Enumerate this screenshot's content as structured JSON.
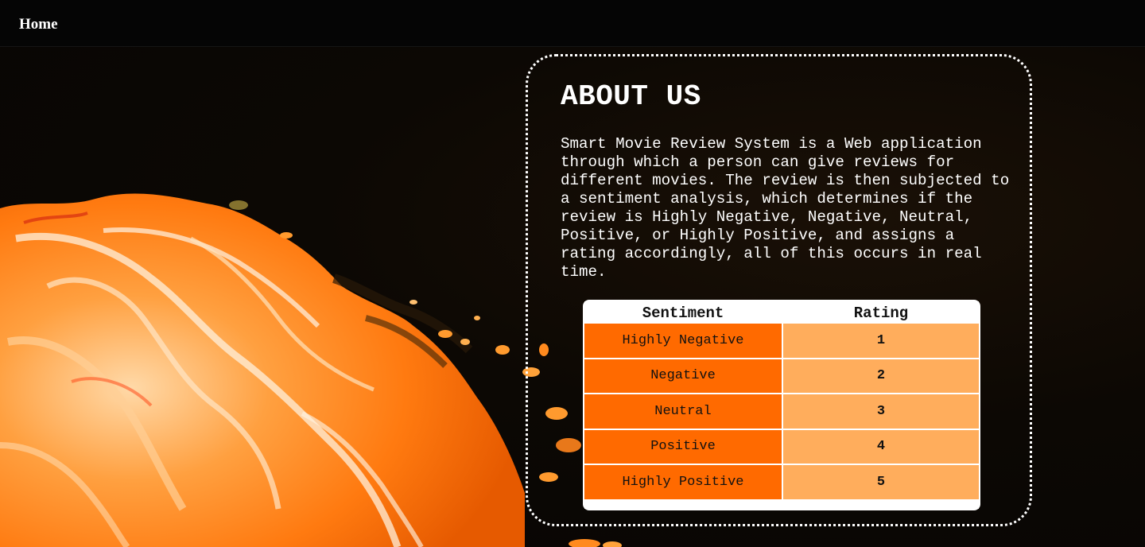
{
  "nav": {
    "home_label": "Home"
  },
  "about": {
    "title": "ABOUT US",
    "description": "Smart Movie Review System is a Web application\nthrough which a person can give reviews for\ndifferent movies. The review is then subjected to\na sentiment analysis, which determines if the\nreview is Highly Negative, Negative, Neutral,\nPositive, or Highly Positive, and assigns a\nrating accordingly, all of this occurs in real\ntime."
  },
  "table": {
    "headers": [
      "Sentiment",
      "Rating"
    ],
    "rows": [
      {
        "sentiment": "Highly Negative",
        "rating": "1"
      },
      {
        "sentiment": "Negative",
        "rating": "2"
      },
      {
        "sentiment": "Neutral",
        "rating": "3"
      },
      {
        "sentiment": "Positive",
        "rating": "4"
      },
      {
        "sentiment": "Highly Positive",
        "rating": "5"
      }
    ]
  },
  "colors": {
    "sentiment_cell": "#ff6a00",
    "rating_cell": "#ffad5c",
    "background": "#0b0704",
    "nav_background": "#050505"
  },
  "background_image": "orange-fluid-paint-art"
}
